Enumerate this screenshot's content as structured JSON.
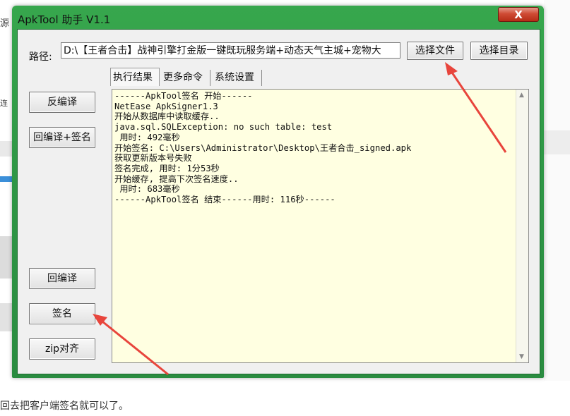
{
  "background": {
    "fragment_1": "源",
    "fragment_2": "连",
    "caption": "回去把客户端签名就可以了。"
  },
  "window": {
    "title": "ApkTool 助手 V1.1",
    "close_label": "X"
  },
  "path": {
    "label": "路径:",
    "value": "D:\\【王者合击】战神引擎打金版一键既玩服务端+动态天气主城+宠物大"
  },
  "buttons": {
    "choose_file": "选择文件",
    "choose_dir": "选择目录",
    "decompile": "反编译",
    "recompile_sign": "回编译+签名",
    "recompile": "回编译",
    "sign": "签名",
    "zipalign": "zip对齐"
  },
  "tabs": [
    {
      "label": "执行结果"
    },
    {
      "label": "更多命令"
    },
    {
      "label": "系统设置"
    }
  ],
  "output_lines": [
    "------ApkTool签名 开始------",
    "NetEase ApkSigner1.3",
    "开始从数据库中读取缓存..",
    "java.sql.SQLException: no such table: test",
    " 用时: 492毫秒",
    "开始签名: C:\\Users\\Administrator\\Desktop\\王者合击_signed.apk",
    "获取更新版本号失败",
    "签名完成, 用时: 1分53秒",
    "开始缓存, 提高下次签名速度..",
    " 用时: 683毫秒",
    "------ApkTool签名 结束------用时: 116秒------"
  ],
  "colors": {
    "frame": "#2f9846",
    "output_bg": "#ffffe1",
    "arrow": "#e8453c",
    "close": "#cf4b34"
  }
}
